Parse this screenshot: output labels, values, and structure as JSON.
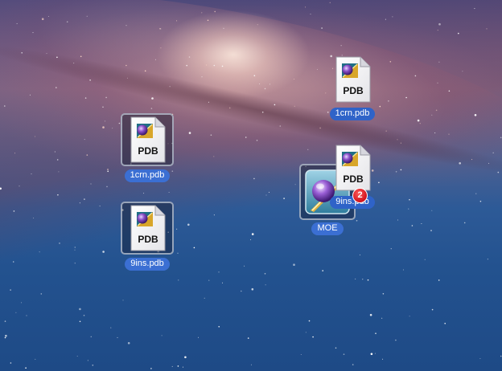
{
  "desktop": {
    "icons": [
      {
        "label": "1crn.pdb",
        "doc_text": "PDB",
        "selected": true,
        "icon": "pdb-document-icon"
      },
      {
        "label": "9ins.pdb",
        "doc_text": "PDB",
        "selected": true,
        "icon": "pdb-document-icon"
      },
      {
        "label": "1crn.pdb",
        "doc_text": "PDB",
        "selected": false,
        "icon": "pdb-document-icon"
      },
      {
        "label": "9ins.pdb",
        "doc_text": "PDB",
        "selected": false,
        "icon": "pdb-document-icon"
      },
      {
        "label": "MOE",
        "selected": true,
        "icon": "moe-app-icon"
      }
    ],
    "drag_badge": "2"
  },
  "colors": {
    "label_highlight": "#3b6fd3",
    "badge_red": "#d0121c",
    "sky_blue": "#23528f"
  }
}
